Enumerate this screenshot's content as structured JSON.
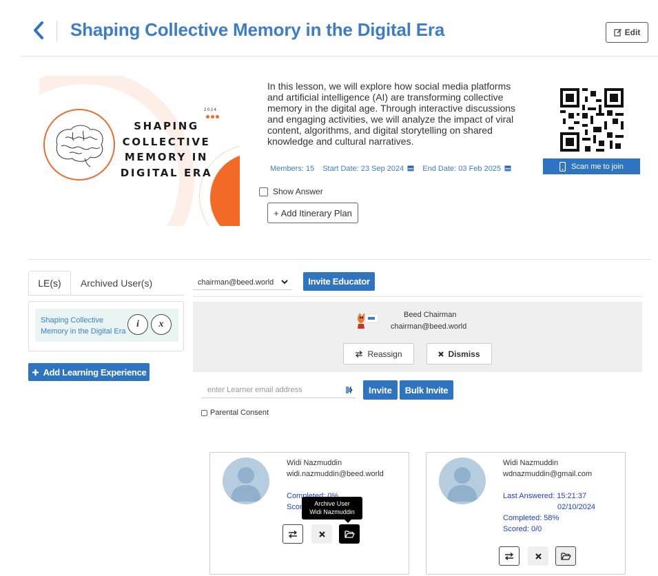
{
  "header": {
    "title": "Shaping Collective Memory in the Digital Era",
    "edit_label": "Edit"
  },
  "banner": {
    "title_lines": [
      "SHAPING",
      "COLLECTIVE",
      "MEMORY IN",
      "DIGITAL ERA"
    ],
    "year": "2024"
  },
  "lesson": {
    "description": "In this lesson, we will explore how social media platforms and artificial intelligence (AI) are transforming collective memory in the digital age. Through interactive discussions and engaging activities, we will analyze the impact of viral content, algorithms, and digital storytelling on shared knowledge and cultural narratives.",
    "members": "Members: 15",
    "start_date": "Start Date: 23 Sep 2024",
    "end_date": "End Date: 03 Feb 2025",
    "show_answer_label": "Show Answer",
    "add_itinerary_label": "+ Add Itinerary Plan"
  },
  "qr": {
    "scan_label": "Scan me to join"
  },
  "tabs": [
    {
      "label": "LE(s)",
      "active": true
    },
    {
      "label": "Archived User(s)",
      "active": false
    }
  ],
  "le_list": [
    {
      "label": "Shaping Collective Memory in the Digital Era",
      "info_label": "i",
      "remove_label": "x"
    }
  ],
  "add_le_label": "Add Learning Experience",
  "educator": {
    "selected": "chairman@beed.world",
    "invite_label": "Invite Educator",
    "name": "Beed Chairman",
    "email": "chairman@beed.world",
    "reassign_label": "Reassign",
    "dismiss_label": "Dismiss"
  },
  "learner_invite": {
    "placeholder": "enter Learner email address",
    "invite_label": "Invite",
    "bulk_invite_label": "Bulk Invite",
    "parental_consent_label": "Parental Consent"
  },
  "learners": [
    {
      "name": "Widi Nazmuddin",
      "email": "widi.nazmuddin@beed.world",
      "completed": "Completed: 0%",
      "scored": "Scored: 0/0"
    },
    {
      "name": "Widi Nazmuddin",
      "email": "wdnazmuddin@gmail.com",
      "last_answered": "Last Answered: 15:21:37",
      "last_answered_date": "02/10/2024",
      "completed": "Completed: 58%",
      "scored": "Scored: 0/0"
    }
  ],
  "tooltip": {
    "line1": "Archive User",
    "line2": "Widi Nazmuddin"
  },
  "colors": {
    "primary": "#2e74c0",
    "title_blue": "#3d7cc9",
    "accent_orange": "#f36a27",
    "stat_blue": "#1f3cd0"
  }
}
